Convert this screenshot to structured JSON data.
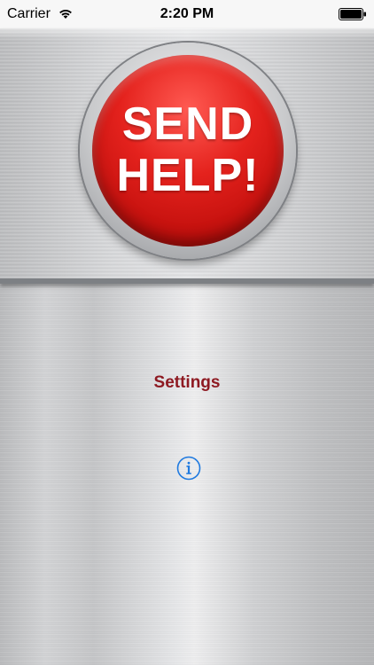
{
  "status_bar": {
    "carrier": "Carrier",
    "time": "2:20 PM",
    "wifi_icon": "wifi-icon",
    "battery_icon": "battery-icon"
  },
  "main": {
    "help_button": {
      "line1": "SEND",
      "line2": "HELP!",
      "color": "#d41713"
    },
    "settings_label": "Settings",
    "settings_color": "#8e1a22",
    "info_icon": "info-icon",
    "info_color": "#1f7ae0"
  }
}
